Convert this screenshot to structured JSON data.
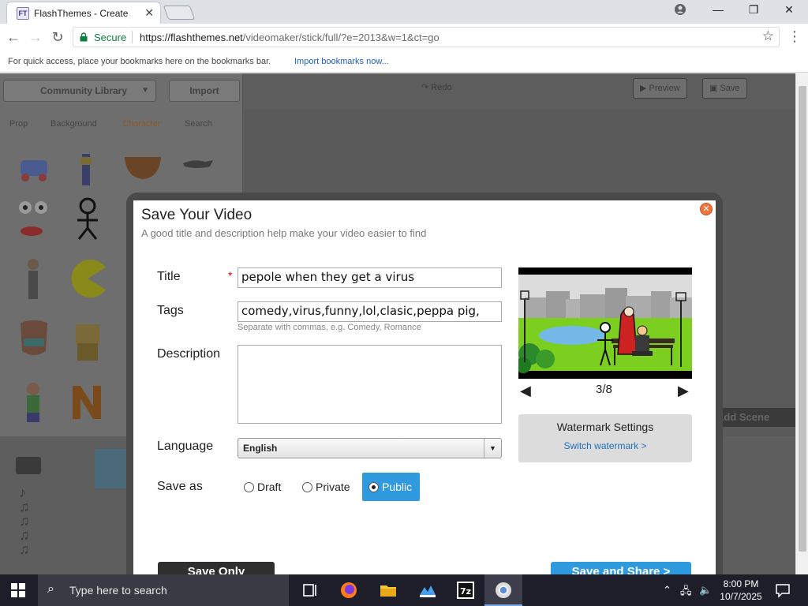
{
  "browser": {
    "tab_title": "FlashThemes - Create",
    "tab_favicon": "FT",
    "secure_label": "Secure",
    "url_host": "https://flashthemes.net",
    "url_path": "/videomaker/stick/full/?e=2013&w=1&ct=go",
    "bookmarks_text": "For quick access, place your bookmarks here on the bookmarks bar.",
    "bookmarks_link": "Import bookmarks now..."
  },
  "app": {
    "library_label": "Community Library",
    "import_label": "Import",
    "tabs": [
      "Prop",
      "Background",
      "Character",
      "Search"
    ],
    "preview_label": "Preview",
    "save_label": "Save",
    "redo_label": "Redo",
    "add_scene_label": "Add Scene"
  },
  "dialog": {
    "title": "Save Your Video",
    "subtitle": "A good title and description help make your video easier to find",
    "title_label": "Title",
    "title_value": "pepole when they get a virus",
    "tags_label": "Tags",
    "tags_value": "comedy,virus,funny,lol,clasic,peppa pig,",
    "tags_hint": "Separate with commas, e.g. Comedy, Romance",
    "description_label": "Description",
    "description_value": "",
    "language_label": "Language",
    "language_value": "English",
    "save_as_label": "Save as",
    "save_options": [
      "Draft",
      "Private",
      "Public"
    ],
    "save_selected": "Public",
    "thumbnail_counter": "3/8",
    "watermark_title": "Watermark Settings",
    "watermark_link": "Switch watermark >",
    "save_only_label": "Save Only",
    "save_share_label": "Save and Share >"
  },
  "taskbar": {
    "search_placeholder": "Type here to search",
    "time": "8:00 PM",
    "date": "10/7/2025"
  },
  "colors": {
    "accent_blue": "#2f9ade",
    "close_orange": "#f0743b",
    "secure_green": "#0b8043"
  }
}
